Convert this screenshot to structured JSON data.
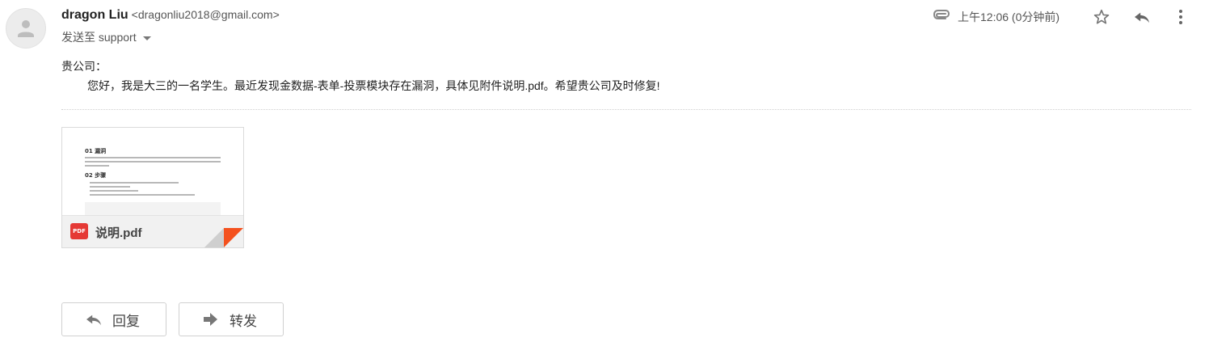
{
  "sender": {
    "name": "dragon Liu",
    "email": "<dragonliu2018@gmail.com>",
    "to_label": "发送至 support"
  },
  "timestamp": "上午12:06 (0分钟前)",
  "icons": {
    "avatar": "avatar-person-icon",
    "attachment_clip": "paperclip-icon",
    "star": "star-icon",
    "reply": "reply-icon",
    "more": "more-vert-icon",
    "caret": "chevron-down-icon",
    "pdf": "pdf-icon",
    "forward": "forward-icon"
  },
  "message": {
    "greeting": "贵公司：",
    "body": "您好，我是大三的一名学生。最近发现金数据-表单-投票模块存在漏洞，具体见附件说明.pdf。希望贵公司及时修复!"
  },
  "attachment": {
    "filename": "说明.pdf",
    "preview_heading_1": "01 漏洞",
    "preview_heading_2": "02 步骤",
    "badge": "PDF"
  },
  "actions": {
    "reply_label": "回复",
    "forward_label": "转发"
  },
  "colors": {
    "pdf_red": "#e53935",
    "fold_red": "#f4511e"
  }
}
